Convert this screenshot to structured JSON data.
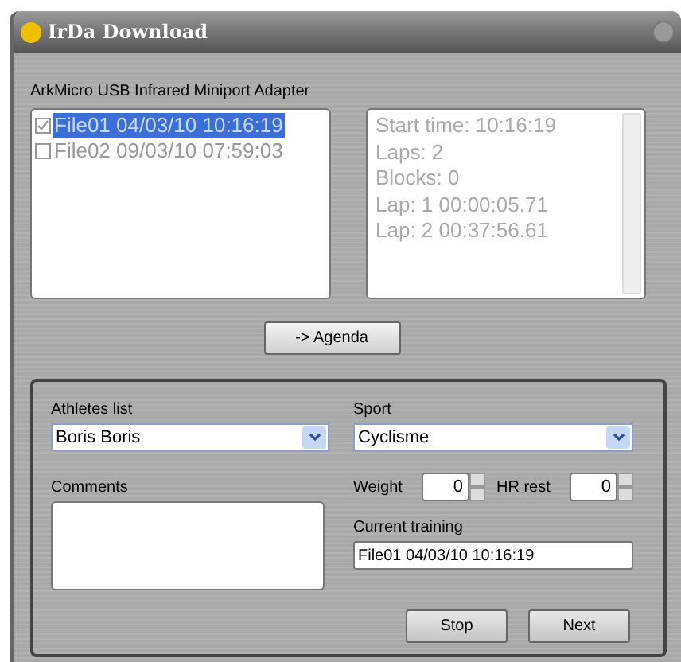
{
  "window": {
    "title": "IrDa Download"
  },
  "adapter_label": "ArkMicro USB Infrared Miniport Adapter",
  "files": [
    {
      "label": "File01 04/03/10 10:16:19",
      "checked": true,
      "selected": true
    },
    {
      "label": "File02 09/03/10 07:59:03",
      "checked": false,
      "selected": false
    }
  ],
  "details": [
    "Start time: 10:16:19",
    "Laps: 2",
    "Blocks: 0",
    "Lap: 1 00:00:05.71",
    "Lap: 2 00:37:56.61"
  ],
  "agenda_button": "-> Agenda",
  "athletes": {
    "label": "Athletes list",
    "value": "Boris Boris"
  },
  "sport": {
    "label": "Sport",
    "value": "Cyclisme"
  },
  "comments": {
    "label": "Comments"
  },
  "weight": {
    "label": "Weight",
    "value": "0"
  },
  "hr_rest": {
    "label": "HR rest",
    "value": "0"
  },
  "current_training": {
    "label": "Current training",
    "value": "File01 04/03/10 10:16:19"
  },
  "buttons": [
    "Stop",
    "Next"
  ]
}
